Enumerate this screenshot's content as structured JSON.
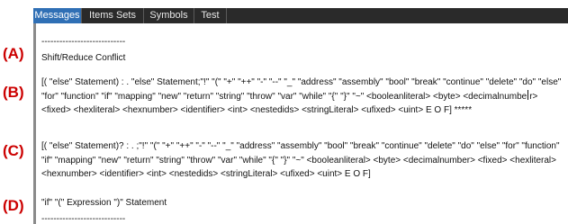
{
  "tabs": [
    {
      "label": "Messages",
      "active": true
    },
    {
      "label": "Items Sets",
      "active": false
    },
    {
      "label": "Symbols",
      "active": false
    },
    {
      "label": "Test",
      "active": false
    }
  ],
  "labels": {
    "a": "(A)",
    "b": "(B)",
    "c": "(C)",
    "d": "(D)"
  },
  "messages": {
    "sep_top": "----------------------------",
    "title": "Shift/Reduce Conflict",
    "item_b_pre": "[( \"else\" Statement) : .  \"else\" Statement;\"!\" \"(\" \"+\" \"++\" \"-\" \"--\" \"_\" \"address\" \"assembly\" \"bool\" \"break\" \"continue\" \"delete\" \"do\" \"else\" \"for\" \"function\" \"if\" \"mapping\" \"new\" \"return\" \"string\" \"throw\" \"var\" \"while\" \"{\" \"}\" \"~\" <booleanliteral> <byte> <decimalnumbe",
    "item_b_post": "r> <fixed> <hexliteral> <hexnumber> <identifier> <int> <nestedids> <stringLiteral> <ufixed> <uint> E O F]    *****",
    "item_c": "[( \"else\" Statement)? : . ;\"!\" \"(\" \"+\" \"++\" \"-\" \"--\" \"_\" \"address\" \"assembly\" \"bool\" \"break\" \"continue\" \"delete\" \"do\" \"else\" \"for\" \"function\" \"if\" \"mapping\" \"new\" \"return\" \"string\" \"throw\" \"var\" \"while\" \"{\" \"}\" \"~\" <booleanliteral> <byte> <decimalnumber> <fixed> <hexliteral> <hexnumber> <identifier> <int> <nestedids> <stringLiteral> <ufixed> <uint> E O F]",
    "item_d": "\"if\" \"(\" Expression \")\" Statement",
    "sep_bottom": "----------------------------"
  }
}
